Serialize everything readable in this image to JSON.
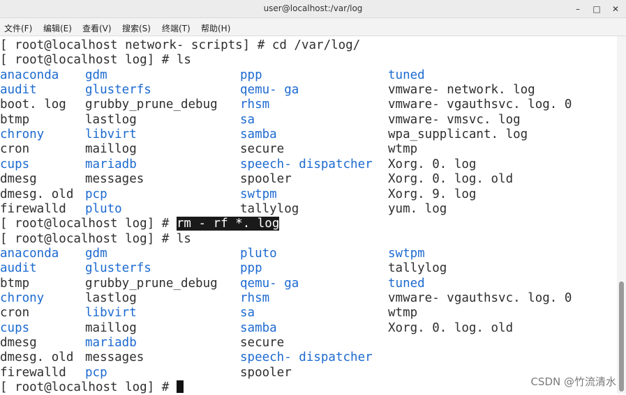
{
  "window": {
    "title": "user@localhost:/var/log"
  },
  "menu": [
    "文件(F)",
    "编辑(E)",
    "查看(V)",
    "搜索(S)",
    "终端(T)",
    "帮助(H)"
  ],
  "terminal": {
    "lines": [
      {
        "type": "cmd",
        "prompt": "[ root@localhost network- scripts] # ",
        "command": "cd /var/log/"
      },
      {
        "type": "cmd",
        "prompt": "[ root@localhost log] # ",
        "command": "ls"
      },
      {
        "type": "ls",
        "cols": [
          {
            "t": "anaconda",
            "d": true
          },
          {
            "t": "gdm",
            "d": true
          },
          {
            "t": "ppp",
            "d": true
          },
          {
            "t": "tuned",
            "d": true
          }
        ]
      },
      {
        "type": "ls",
        "cols": [
          {
            "t": "audit",
            "d": true
          },
          {
            "t": "glusterfs",
            "d": true
          },
          {
            "t": "qemu- ga",
            "d": true
          },
          {
            "t": "vmware- network. log",
            "d": false
          }
        ]
      },
      {
        "type": "ls",
        "cols": [
          {
            "t": "boot. log",
            "d": false
          },
          {
            "t": "grubby_prune_debug",
            "d": false
          },
          {
            "t": "rhsm",
            "d": true
          },
          {
            "t": "vmware- vgauthsvc. log. 0",
            "d": false
          }
        ]
      },
      {
        "type": "ls",
        "cols": [
          {
            "t": "btmp",
            "d": false
          },
          {
            "t": "lastlog",
            "d": false
          },
          {
            "t": "sa",
            "d": true
          },
          {
            "t": "vmware- vmsvc. log",
            "d": false
          }
        ]
      },
      {
        "type": "ls",
        "cols": [
          {
            "t": "chrony",
            "d": true
          },
          {
            "t": "libvirt",
            "d": true
          },
          {
            "t": "samba",
            "d": true
          },
          {
            "t": "wpa_supplicant. log",
            "d": false
          }
        ]
      },
      {
        "type": "ls",
        "cols": [
          {
            "t": "cron",
            "d": false
          },
          {
            "t": "maillog",
            "d": false
          },
          {
            "t": "secure",
            "d": false
          },
          {
            "t": "wtmp",
            "d": false
          }
        ]
      },
      {
        "type": "ls",
        "cols": [
          {
            "t": "cups",
            "d": true
          },
          {
            "t": "mariadb",
            "d": true
          },
          {
            "t": "speech- dispatcher",
            "d": true
          },
          {
            "t": "Xorg. 0. log",
            "d": false
          }
        ]
      },
      {
        "type": "ls",
        "cols": [
          {
            "t": "dmesg",
            "d": false
          },
          {
            "t": "messages",
            "d": false
          },
          {
            "t": "spooler",
            "d": false
          },
          {
            "t": "Xorg. 0. log. old",
            "d": false
          }
        ]
      },
      {
        "type": "ls",
        "cols": [
          {
            "t": "dmesg. old",
            "d": false
          },
          {
            "t": "pcp",
            "d": true
          },
          {
            "t": "swtpm",
            "d": true
          },
          {
            "t": "Xorg. 9. log",
            "d": false
          }
        ]
      },
      {
        "type": "ls",
        "cols": [
          {
            "t": "firewalld",
            "d": false
          },
          {
            "t": "pluto",
            "d": true
          },
          {
            "t": "tallylog",
            "d": false
          },
          {
            "t": "yum. log",
            "d": false
          }
        ]
      },
      {
        "type": "cmd",
        "prompt": "[ root@localhost log] # ",
        "command": "rm - rf *. log",
        "selected": true
      },
      {
        "type": "cmd",
        "prompt": "[ root@localhost log] # ",
        "command": "ls"
      },
      {
        "type": "ls",
        "cols": [
          {
            "t": "anaconda",
            "d": true
          },
          {
            "t": "gdm",
            "d": true
          },
          {
            "t": "pluto",
            "d": true
          },
          {
            "t": "swtpm",
            "d": true
          }
        ]
      },
      {
        "type": "ls",
        "cols": [
          {
            "t": "audit",
            "d": true
          },
          {
            "t": "glusterfs",
            "d": true
          },
          {
            "t": "ppp",
            "d": true
          },
          {
            "t": "tallylog",
            "d": false
          }
        ]
      },
      {
        "type": "ls",
        "cols": [
          {
            "t": "btmp",
            "d": false
          },
          {
            "t": "grubby_prune_debug",
            "d": false
          },
          {
            "t": "qemu- ga",
            "d": true
          },
          {
            "t": "tuned",
            "d": true
          }
        ]
      },
      {
        "type": "ls",
        "cols": [
          {
            "t": "chrony",
            "d": true
          },
          {
            "t": "lastlog",
            "d": false
          },
          {
            "t": "rhsm",
            "d": true
          },
          {
            "t": "vmware- vgauthsvc. log. 0",
            "d": false
          }
        ]
      },
      {
        "type": "ls",
        "cols": [
          {
            "t": "cron",
            "d": false
          },
          {
            "t": "libvirt",
            "d": true
          },
          {
            "t": "sa",
            "d": true
          },
          {
            "t": "wtmp",
            "d": false
          }
        ]
      },
      {
        "type": "ls",
        "cols": [
          {
            "t": "cups",
            "d": true
          },
          {
            "t": "maillog",
            "d": false
          },
          {
            "t": "samba",
            "d": true
          },
          {
            "t": "Xorg. 0. log. old",
            "d": false
          }
        ]
      },
      {
        "type": "ls",
        "cols": [
          {
            "t": "dmesg",
            "d": false
          },
          {
            "t": "mariadb",
            "d": true
          },
          {
            "t": "secure",
            "d": false
          },
          {
            "t": "",
            "d": false
          }
        ]
      },
      {
        "type": "ls",
        "cols": [
          {
            "t": "dmesg. old",
            "d": false
          },
          {
            "t": "messages",
            "d": false
          },
          {
            "t": "speech- dispatcher",
            "d": true
          },
          {
            "t": "",
            "d": false
          }
        ]
      },
      {
        "type": "ls",
        "cols": [
          {
            "t": "firewalld",
            "d": false
          },
          {
            "t": "pcp",
            "d": true
          },
          {
            "t": "spooler",
            "d": false
          },
          {
            "t": "",
            "d": false
          }
        ]
      },
      {
        "type": "cmd",
        "prompt": "[ root@localhost log] # ",
        "command": "",
        "cursor": true
      }
    ]
  },
  "colors": {
    "directory": "#1c6ad0",
    "text": "#2e2e2e",
    "selection_bg": "#1a1a1a"
  },
  "icons": {
    "minimize": "minimize-icon",
    "maximize": "maximize-icon",
    "close": "close-icon"
  },
  "watermark": "CSDN @竹流清水"
}
